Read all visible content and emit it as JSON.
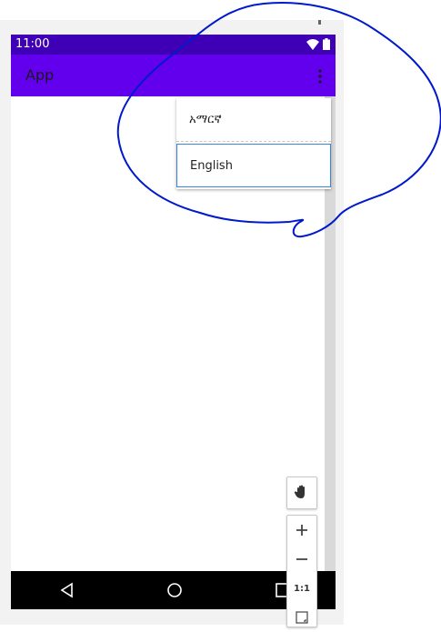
{
  "colors": {
    "status_bar": "#3f00b5",
    "app_bar": "#6200ee",
    "annotation": "#0019cc",
    "selection_border": "#3a86d8"
  },
  "status_bar": {
    "time": "11:00",
    "icons": [
      "wifi-icon",
      "battery-icon"
    ]
  },
  "app_bar": {
    "title": "App",
    "overflow_icon": "more-vert-icon"
  },
  "menu": {
    "items": [
      {
        "label": "አማርኛ"
      },
      {
        "label": "English",
        "selected": true
      }
    ]
  },
  "nav_bar": {
    "icons": [
      "back-icon",
      "home-icon",
      "recents-icon"
    ]
  },
  "zoom_toolbar": {
    "pan_icon": "hand-icon",
    "zoom_in_icon": "plus-icon",
    "zoom_out_icon": "minus-icon",
    "actual_size_label": "1:1",
    "fit_icon": "fit-screen-icon"
  }
}
